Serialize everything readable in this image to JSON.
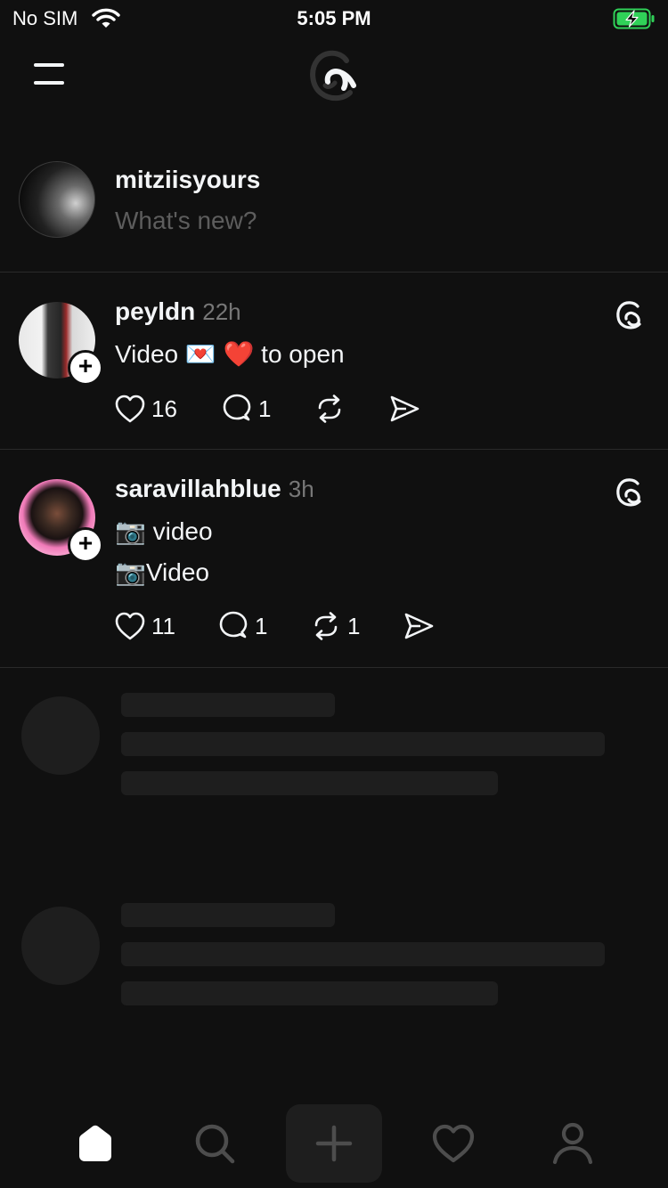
{
  "status_bar": {
    "carrier": "No SIM",
    "time": "5:05 PM",
    "wifi_icon": "wifi-icon",
    "battery_icon": "battery-charging-icon",
    "battery_color": "#30d158"
  },
  "header": {
    "menu_icon": "hamburger-menu-icon",
    "logo_icon": "threads-logo-icon"
  },
  "composer": {
    "username": "mitziisyours",
    "placeholder": "What's new?"
  },
  "posts": [
    {
      "username": "peyldn",
      "time": "22h",
      "lines": [
        "Video 💌 ❤️ to open"
      ],
      "likes": "16",
      "replies": "1",
      "reposts": "",
      "sends": ""
    },
    {
      "username": "saravillahblue",
      "time": "3h",
      "lines": [
        "📷 video",
        "📷Video"
      ],
      "likes": "11",
      "replies": "1",
      "reposts": "1",
      "sends": ""
    }
  ],
  "tab_bar": {
    "tabs": [
      "home-icon",
      "search-icon",
      "plus-icon",
      "heart-icon",
      "profile-icon"
    ],
    "active": "home-icon"
  },
  "colors": {
    "background": "#101010",
    "text": "#f3f5f7",
    "muted": "#777777",
    "placeholder": "#5d5d5d",
    "skeleton": "#1e1e1e",
    "divider": "#2a2a2a"
  }
}
